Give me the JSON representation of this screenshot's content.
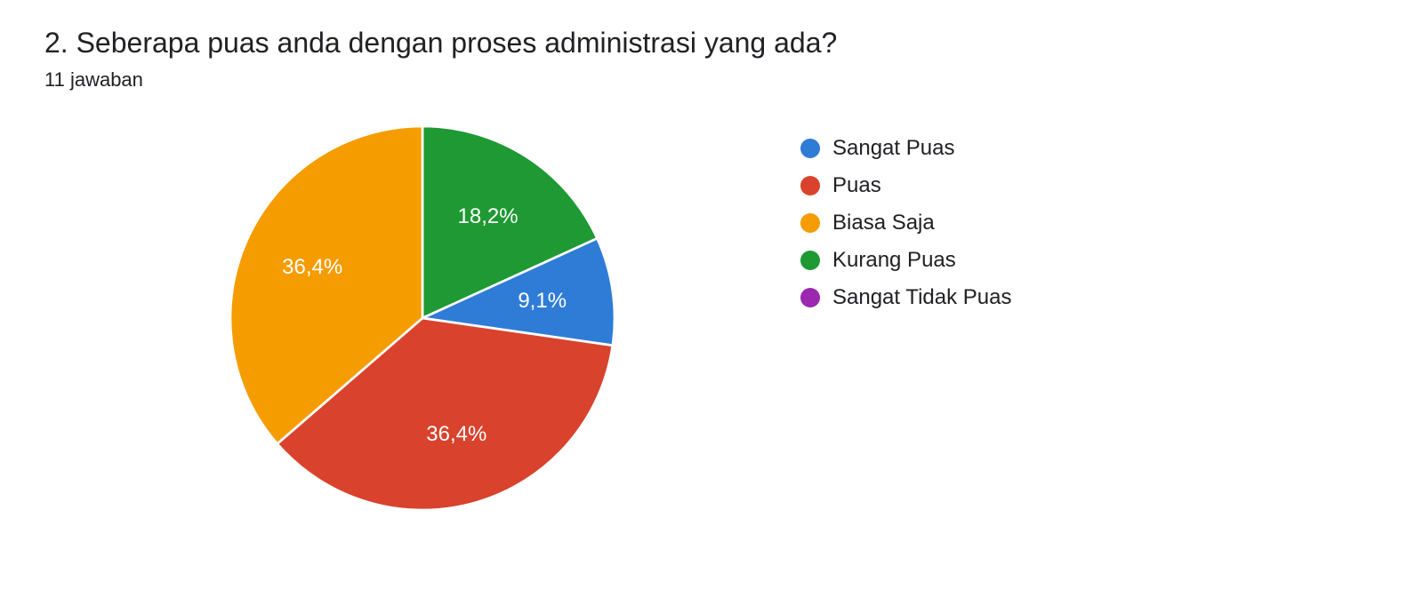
{
  "title": "2. Seberapa puas anda dengan proses administrasi yang ada?",
  "subtitle": "11 jawaban",
  "chart_data": {
    "type": "pie",
    "categories": [
      "Sangat Puas",
      "Puas",
      "Biasa Saja",
      "Kurang Puas",
      "Sangat Tidak Puas"
    ],
    "values": [
      1,
      4,
      4,
      2,
      0
    ],
    "percentages": [
      "9,1%",
      "36,4%",
      "36,4%",
      "18,2%",
      ""
    ],
    "colors": [
      "#2F7CD7",
      "#D9422C",
      "#F59C00",
      "#1E9933",
      "#9C27B0"
    ],
    "total_responses": 11
  },
  "legend": {
    "items": [
      {
        "label": "Sangat Puas",
        "color": "#2F7CD7"
      },
      {
        "label": "Puas",
        "color": "#D9422C"
      },
      {
        "label": "Biasa Saja",
        "color": "#F59C00"
      },
      {
        "label": "Kurang Puas",
        "color": "#1E9933"
      },
      {
        "label": "Sangat Tidak Puas",
        "color": "#9C27B0"
      }
    ]
  }
}
